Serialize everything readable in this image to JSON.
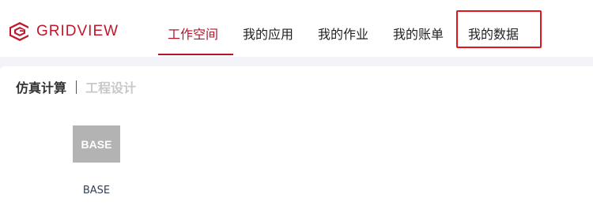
{
  "brand": {
    "name": "GRIDVIEW",
    "color": "#c0172c"
  },
  "nav": {
    "items": [
      {
        "label": "工作空间",
        "active": true
      },
      {
        "label": "我的应用",
        "active": false
      },
      {
        "label": "我的作业",
        "active": false
      },
      {
        "label": "我的账单",
        "active": false
      },
      {
        "label": "我的数据",
        "active": false,
        "highlighted": true
      }
    ],
    "accent_color": "#b3162a",
    "highlight_color": "#e3141b"
  },
  "subtabs": [
    {
      "label": "仿真计算",
      "active": true
    },
    {
      "label": "工程设计",
      "active": false
    }
  ],
  "apps": [
    {
      "icon_text": "BASE",
      "label": "BASE",
      "icon_color": "#b3b3b3"
    }
  ]
}
